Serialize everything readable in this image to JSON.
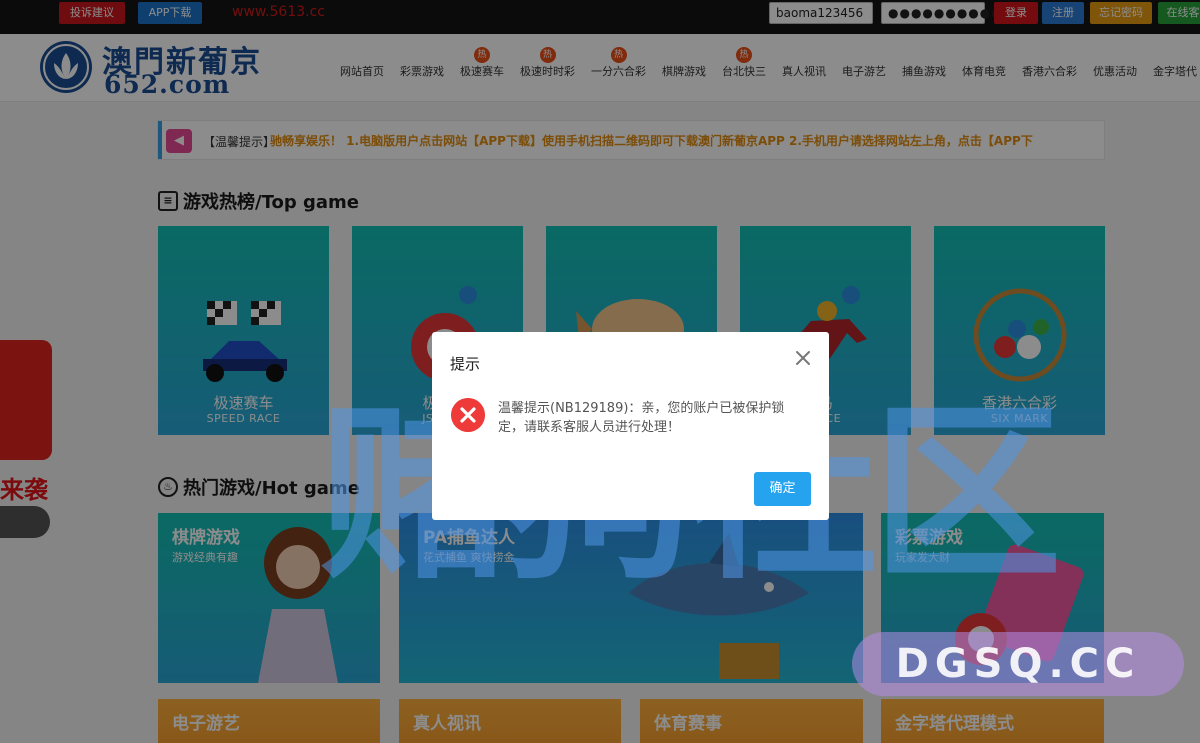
{
  "topbar": {
    "complain_label": "投诉建议",
    "app_label": "APP下载",
    "domain": "www.5613.cc",
    "username_value": "baoma123456",
    "password_value": "●●●●●●●●●●",
    "login_label": "登录",
    "register_label": "注册",
    "forgot_label": "忘记密码",
    "online_label": "在线客"
  },
  "header": {
    "logo_title": "澳門新葡京",
    "logo_sub": "652.com",
    "hot_badge": "热",
    "nav": [
      "网站首页",
      "彩票游戏",
      "极速赛车",
      "极速时时彩",
      "一分六合彩",
      "棋牌游戏",
      "台北快三",
      "真人视讯",
      "电子游艺",
      "捕鱼游戏",
      "体育电竞",
      "香港六合彩",
      "优惠活动",
      "金字塔代"
    ]
  },
  "notice": {
    "title": "【温馨提示】",
    "text": "驰畅享娱乐！ 1.电脑版用户点击网站【APP下载】使用手机扫描二维码即可下载澳门新葡京APP 2.手机用户请选择网站左上角，点击【APP下"
  },
  "sections": {
    "top_game": "游戏热榜/Top game",
    "hot_game": "热门游戏/Hot game"
  },
  "top_games": [
    {
      "name": "极速赛车",
      "en": "SPEED RACE"
    },
    {
      "name": "极速",
      "en": "JS LO"
    },
    {
      "name": "",
      "en": ""
    },
    {
      "name": "马",
      "en": "RACE"
    },
    {
      "name": "香港六合彩",
      "en": "SIX MARK"
    }
  ],
  "hot_games": [
    {
      "title": "棋牌游戏",
      "sub": "游戏经典有趣"
    },
    {
      "title": "PA捕鱼达人",
      "sub": "花式捕鱼 爽快捞金"
    },
    {
      "title": "彩票游戏",
      "sub": "玩家发大财"
    },
    {
      "title": "电子游艺",
      "sub": ""
    },
    {
      "title": "真人视讯",
      "sub": ""
    },
    {
      "title": "体育赛事",
      "sub": ""
    },
    {
      "title": "金字塔代理模式",
      "sub": ""
    }
  ],
  "promo": {
    "text": "来袭"
  },
  "modal": {
    "title": "提示",
    "message": "温馨提示(NB129189)：亲，您的账户已被保护锁定，请联系客服人员进行处理！",
    "ok_label": "确定"
  },
  "watermark": {
    "cn": "赌狗社区",
    "en": "DGSQ.CC"
  },
  "colors": {
    "accent_red": "#d3161c",
    "accent_blue": "#26a3ef",
    "error_red": "#ef3a3a",
    "brand_blue": "#1b4e92"
  }
}
